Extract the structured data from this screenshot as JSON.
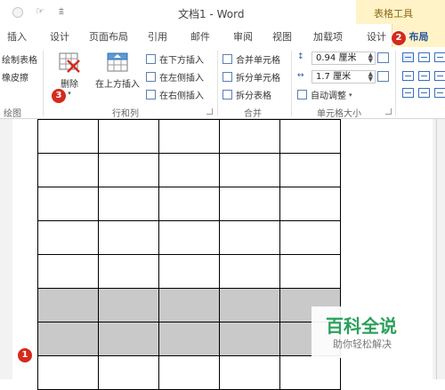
{
  "titlebar": {
    "quick_access_icon": "cursor-icon",
    "dropdown_glyph": "⩲",
    "title": "文档1 - Word",
    "context_group": "表格工具"
  },
  "tabs": [
    {
      "label": "插入"
    },
    {
      "label": "设计"
    },
    {
      "label": "页面布局"
    },
    {
      "label": "引用"
    },
    {
      "label": "邮件"
    },
    {
      "label": "审阅"
    },
    {
      "label": "视图"
    },
    {
      "label": "加载项"
    },
    {
      "label": "设计"
    },
    {
      "label": "布局"
    }
  ],
  "ribbon": {
    "draw": {
      "draw_table": "绘制表格",
      "eraser": "橡皮擦",
      "group_label": "绘图"
    },
    "rows_cols": {
      "delete": "删除",
      "insert_above": "在上方插入",
      "insert_below": "在下方插入",
      "insert_left": "在左侧插入",
      "insert_right": "在右侧插入",
      "group_label": "行和列"
    },
    "merge": {
      "merge_cells": "合并单元格",
      "split_cells": "拆分单元格",
      "split_table": "拆分表格",
      "group_label": "合并"
    },
    "cell_size": {
      "height": "0.94 厘米",
      "width": "1.7 厘米",
      "autofit": "自动调整",
      "group_label": "单元格大小"
    }
  },
  "badges": {
    "one": "1",
    "two": "2",
    "three": "3"
  },
  "watermark": {
    "main": "百科全说",
    "sub": "助你轻松解决"
  },
  "colors": {
    "badge_red": "#d42a1d",
    "context_tab_yellow": "#fff3c7",
    "selection_gray": "#c9c9c9",
    "watermark_green": "#2aa05a",
    "ribbon_blue": "#2b579a"
  }
}
